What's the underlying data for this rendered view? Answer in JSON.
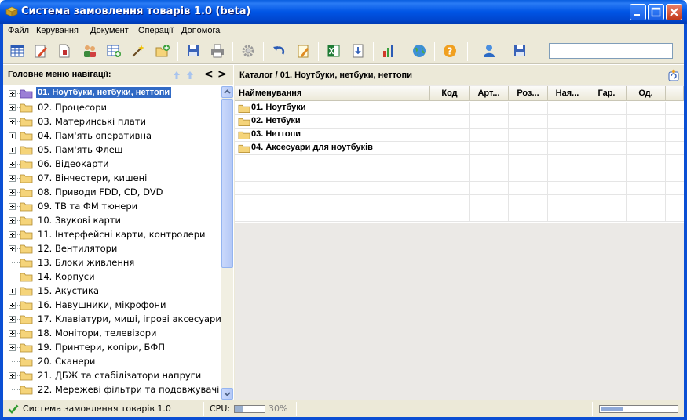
{
  "window": {
    "title": "Система замовлення товарів 1.0 (beta)"
  },
  "menu": [
    "Файл",
    "Керування",
    "Документ",
    "Операції",
    "Допомога"
  ],
  "toolbar": {
    "buttons": [
      "table-icon",
      "edit-icon",
      "document-icon",
      "users-icon",
      "add-table-icon",
      "wand-icon",
      "new-folder-icon",
      "save-icon",
      "print-icon",
      "settings-icon",
      "undo-icon",
      "notepad-icon",
      "excel-icon",
      "import-icon",
      "chart-icon",
      "globe-icon",
      "help-icon",
      "user-icon",
      "save-all-icon"
    ],
    "search_value": ""
  },
  "navigation": {
    "title": "Головне меню навігації:",
    "prev": "<",
    "next": ">",
    "items": [
      "01. Ноутбуки, нетбуки, неттопи",
      "02. Процесори",
      "03. Материнські плати",
      "04. Пам'ять оперативна",
      "05. Пам'ять Флеш",
      "06. Відеокарти",
      "07. Вінчестери, кишені",
      "08. Приводи FDD, CD, DVD",
      "09. ТВ та ФМ тюнери",
      "10. Звукові карти",
      "11. Інтерфейсні карти, контролери",
      "12. Вентилятори",
      "13. Блоки живлення",
      "14. Корпуси",
      "15. Акустика",
      "16. Навушники, мікрофони",
      "17. Клавіатури, миші, ігрові аксесуари",
      "18. Монітори, телевізори",
      "19. Принтери, копіри, БФП",
      "20. Сканери",
      "21. ДБЖ та стабілізатори напруги",
      "22. Мережеві фільтри та подовжувачі"
    ],
    "selected_index": 0
  },
  "catalog": {
    "breadcrumb": "Каталог / 01. Ноутбуки, нетбуки, неттопи",
    "columns": [
      "Найменування",
      "Код",
      "Арт...",
      "Роз...",
      "Ная...",
      "Гар.",
      "Од."
    ],
    "rows": [
      "01. Ноутбуки",
      "02. Нетбуки",
      "03. Неттопи",
      "04. Аксесуари для ноутбуків"
    ]
  },
  "status": {
    "text": "Система замовлення товарів 1.0",
    "cpu_label": "CPU:",
    "cpu_value": "30%",
    "cpu_fraction": 0.3,
    "progress_fraction": 0.3
  },
  "colors": {
    "titlebar": "#0055e5",
    "selection": "#316ac5",
    "folder": "#f5d47a"
  }
}
